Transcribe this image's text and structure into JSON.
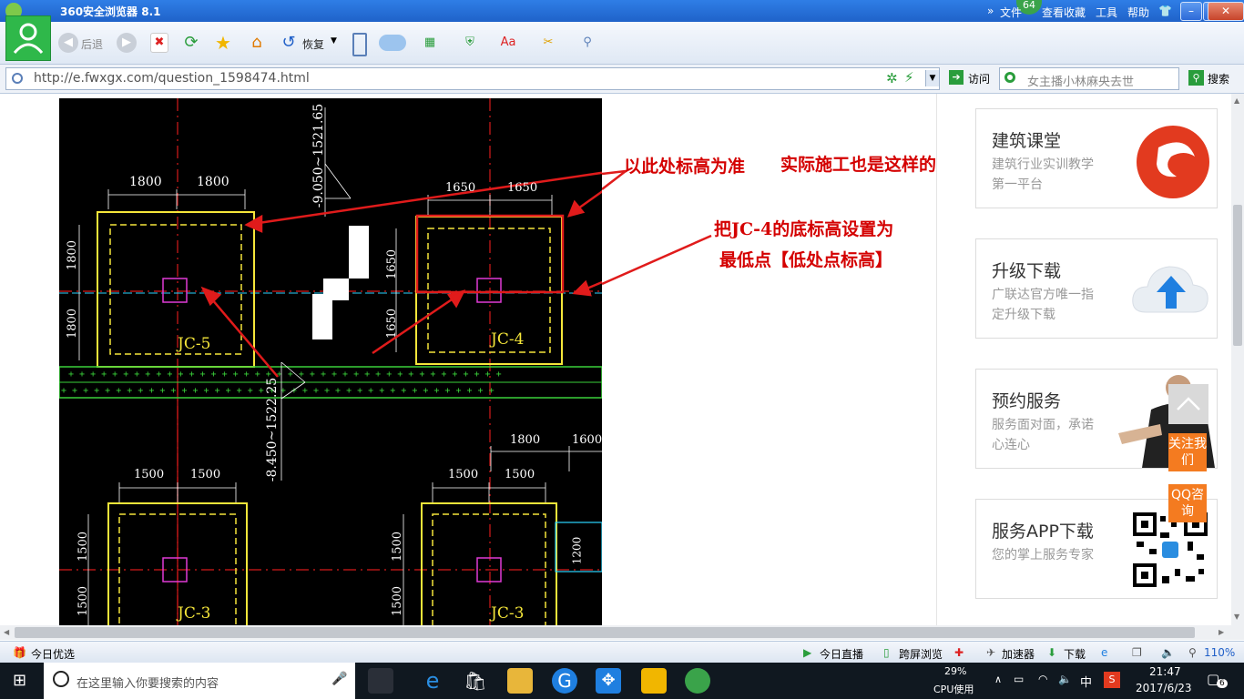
{
  "window": {
    "title": "360安全浏览器 8.1",
    "badge": "64"
  },
  "menu": {
    "file": "文件",
    "view": "查看",
    "favorites": "收藏",
    "tools": "工具",
    "help": "帮助"
  },
  "toolbar": {
    "back": "后退",
    "restore": "恢复"
  },
  "address": {
    "url": "http://e.fwxgx.com/question_1598474.html",
    "go": "访问",
    "search_placeholder": "女主播小林麻央去世",
    "search_btn": "搜索"
  },
  "cad": {
    "dims": [
      "1800",
      "1800",
      "1800",
      "1800",
      "1650",
      "1650",
      "1650",
      "1650",
      "1800",
      "1600",
      "1500",
      "1500",
      "1500",
      "1500",
      "1500",
      "1500",
      "1500",
      "1500",
      "1200"
    ],
    "elev1": "-9.050~1521.65",
    "elev2": "-8.450~1522.25",
    "labels": [
      "JC-5",
      "JC-4",
      "JC-3",
      "JC-3"
    ]
  },
  "annotations": {
    "a1": "以此处标高为准",
    "a2": "实际施工也是这样的",
    "a3_line1": "把JC-4的底标高设置为",
    "a3_line2": "最低点【低处点标高】"
  },
  "sidebar": {
    "cards": [
      {
        "title": "建筑课堂",
        "desc": "建筑行业实训教学第一平台"
      },
      {
        "title": "升级下载",
        "desc": "广联达官方唯一指定升级下载"
      },
      {
        "title": "预约服务",
        "desc": "服务面对面，承诺心连心"
      },
      {
        "title": "服务APP下载",
        "desc": "您的掌上服务专家"
      }
    ],
    "follow": "关注我们",
    "qq": "QQ咨询"
  },
  "status": {
    "left": "今日优选",
    "live": "今日直播",
    "cross": "跨屏浏览",
    "accel": "加速器",
    "download": "下载",
    "zoom": "110%"
  },
  "taskbar": {
    "search": "在这里输入你要搜索的内容",
    "cpu": "29%",
    "cpu_label": "CPU使用",
    "ime": "中",
    "time": "21:47",
    "date": "2017/6/23",
    "notif": "6"
  },
  "colors": {
    "accent": "#2f7ee6",
    "annot": "#d40000",
    "orange": "#f47b20"
  }
}
